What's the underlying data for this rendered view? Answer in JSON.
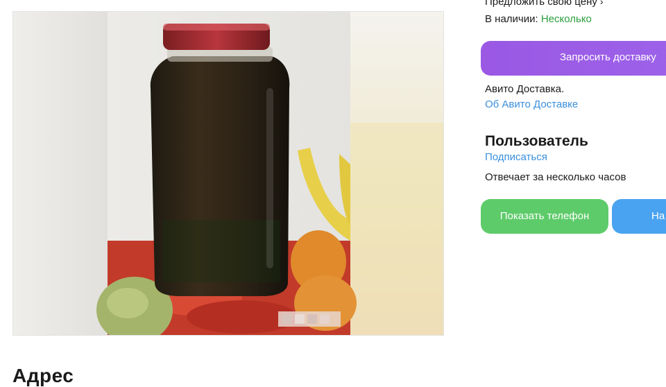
{
  "listing": {
    "photo_alt": "Фото объявления"
  },
  "sidebar": {
    "offer_price_label": "Предложить свою цену",
    "offer_chevron": "›",
    "availability_label": "В наличии:",
    "availability_value": "Несколько",
    "request_delivery_button": "Запросить доставку",
    "delivery_note": "Авито Доставка.",
    "delivery_link": "Об Авито Доставке"
  },
  "seller": {
    "name": "Пользователь",
    "subscribe_link": "Подписаться",
    "response_time": "Отвечает за несколько часов",
    "show_phone_button": "Показать телефон",
    "message_button_partial": "На"
  },
  "main": {
    "section_heading_partial": "Адрес"
  },
  "colors": {
    "accent_purple": "#9b5de5",
    "accent_green": "#5ecb6a",
    "accent_blue": "#4aa3f0",
    "link_blue": "#3a8fdc",
    "availability_green": "#2b9e3e"
  },
  "icons": {
    "offer_chevron": "chevron-right-icon"
  }
}
